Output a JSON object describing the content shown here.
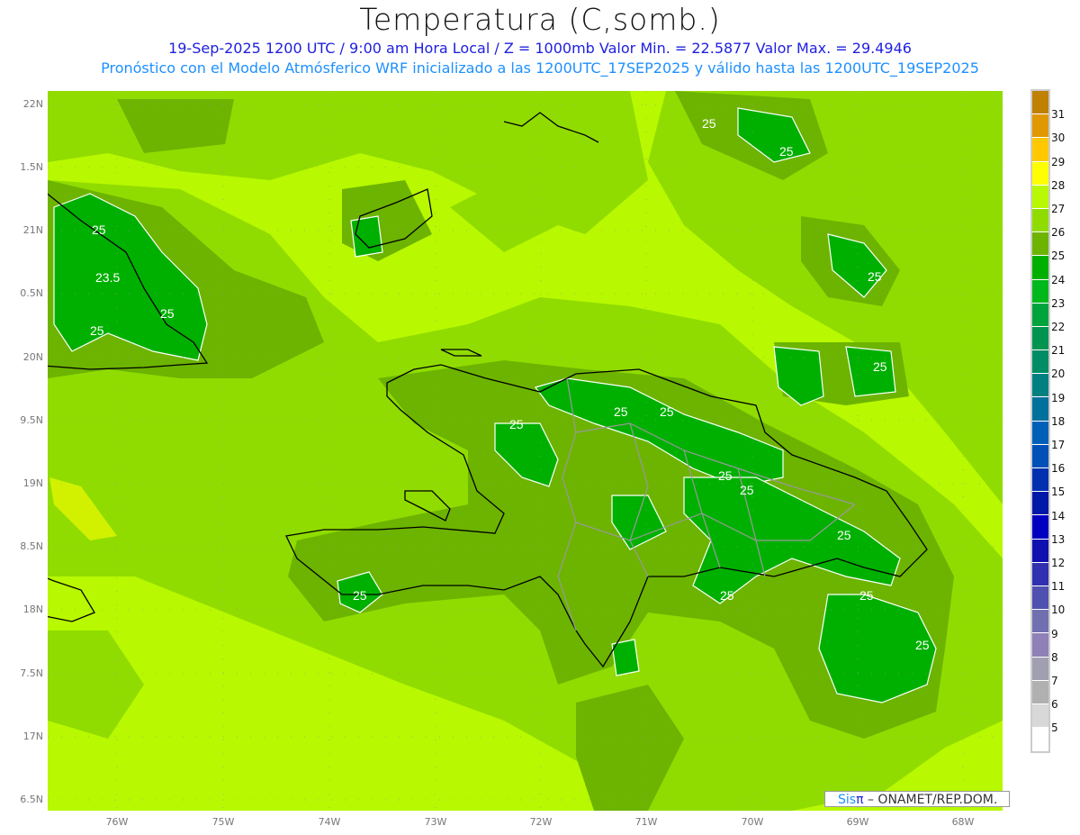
{
  "header": {
    "title": "Temperatura (C,somb.)",
    "subtitle1": "19-Sep-2025  1200 UTC / 9:00 am Hora Local / Z = 1000mb    Valor Min. = 22.5877  Valor Max. = 29.4946",
    "subtitle2": "Pronóstico con el Modelo Atmósferico WRF inicializado a las 1200UTC_17SEP2025 y válido hasta las  1200UTC_19SEP2025"
  },
  "axes": {
    "lat_labels": [
      "22N",
      "1.5N",
      "21N",
      "0.5N",
      "20N",
      "9.5N",
      "19N",
      "8.5N",
      "18N",
      "7.5N",
      "17N",
      "6.5N"
    ],
    "lon_labels": [
      "76W",
      "75W",
      "74W",
      "73W",
      "72W",
      "71W",
      "70W",
      "69W",
      "68W"
    ]
  },
  "colorbar": {
    "labels": [
      "31",
      "30",
      "29",
      "28",
      "27",
      "26",
      "25",
      "24",
      "23",
      "22",
      "21",
      "20",
      "19",
      "18",
      "17",
      "16",
      "15",
      "14",
      "13",
      "12",
      "11",
      "10",
      "9",
      "8",
      "7",
      "6",
      "5"
    ],
    "colors": [
      "#c08000",
      "#e09800",
      "#ffc800",
      "#ffff00",
      "#b8f800",
      "#90dc00",
      "#6cb400",
      "#00b000",
      "#00b81c",
      "#00a43c",
      "#009450",
      "#008c64",
      "#008080",
      "#00709c",
      "#0060b8",
      "#0050b8",
      "#0030b0",
      "#0018a8",
      "#0000c0",
      "#1010b0",
      "#3030b0",
      "#5050b0",
      "#7070b0",
      "#9080b8",
      "#a0a0b0",
      "#b0b0b0",
      "#d8d8d8",
      "#ffffff"
    ]
  },
  "contour_labels": [
    "25",
    "23.5",
    "25",
    "25",
    "25",
    "25",
    "25",
    "25",
    "25",
    "25",
    "25",
    "25",
    "25",
    "25",
    "25",
    "25",
    "25",
    "25"
  ],
  "logo": {
    "sis": "Sis",
    "pi": "π",
    "rest": "– ONAMET/REP.DOM."
  }
}
